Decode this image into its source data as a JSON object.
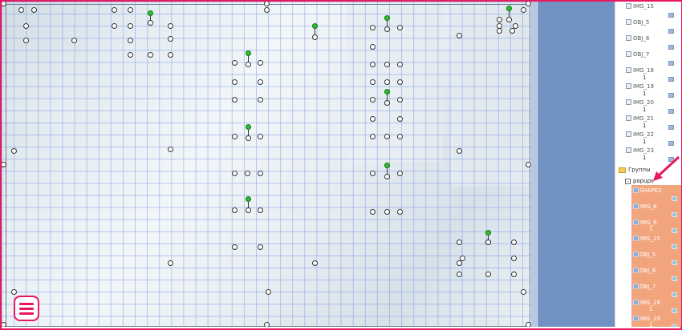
{
  "tree": {
    "items": [
      {
        "label": "IMG_15",
        "count": ""
      },
      {
        "label": "OBJ_5",
        "count": ""
      },
      {
        "label": "OBJ_6",
        "count": ""
      },
      {
        "label": "OBJ_7",
        "count": ""
      },
      {
        "label": "IMG_18",
        "count": "1"
      },
      {
        "label": "IMG_19",
        "count": "1"
      },
      {
        "label": "IMG_20",
        "count": "1"
      },
      {
        "label": "IMG_21",
        "count": "1"
      },
      {
        "label": "IMG_22",
        "count": "1"
      },
      {
        "label": "IMG_23",
        "count": "1"
      }
    ],
    "groups_label": "Группы",
    "popups_label": "popups",
    "popup_items": [
      {
        "label": "SHAPE2",
        "count": ""
      },
      {
        "label": "IMG_8",
        "count": ""
      },
      {
        "label": "IMG_9",
        "count": "1"
      },
      {
        "label": "IMG_15",
        "count": ""
      },
      {
        "label": "OBJ_5",
        "count": ""
      },
      {
        "label": "OBJ_6",
        "count": ""
      },
      {
        "label": "OBJ_7",
        "count": ""
      },
      {
        "label": "IMG_18",
        "count": "1"
      },
      {
        "label": "IMG_19",
        "count": "1"
      }
    ]
  },
  "colors": {
    "accent": "#e8185e",
    "blue_panel": "#7193c4",
    "grid": "#6e8ce6",
    "popup_highlight": "#f2a57d"
  },
  "icons": {
    "menu": "hamburger-menu-icon",
    "arrow": "pointer-arrow-icon",
    "folder": "folder-icon"
  }
}
